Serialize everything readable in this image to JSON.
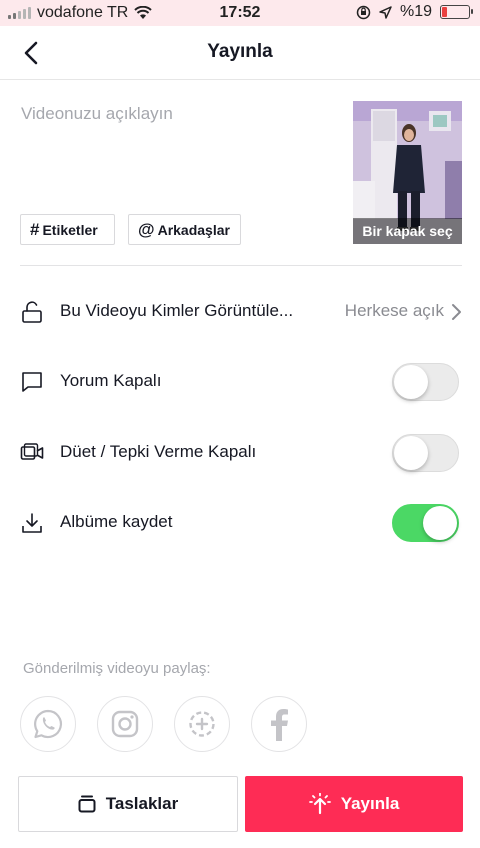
{
  "status_bar": {
    "carrier": "vodafone TR",
    "time": "17:52",
    "battery_percent_label": "%19",
    "battery_level": 0.19,
    "battery_color": "#e84040",
    "icons": [
      "signal-icon",
      "wifi-icon",
      "orientation-lock-icon",
      "location-icon",
      "battery-icon"
    ]
  },
  "header": {
    "title": "Yayınla",
    "back_icon": "chevron-left-icon"
  },
  "description": {
    "placeholder": "Videonuzu açıklayın"
  },
  "cover": {
    "label": "Bir kapak seç"
  },
  "chips": [
    {
      "symbol": "#",
      "label": "Etiketler"
    },
    {
      "symbol": "@",
      "label": "Arkadaşlar"
    }
  ],
  "settings": {
    "privacy": {
      "icon": "unlock-icon",
      "label": "Bu Videoyu Kimler Görüntüle...",
      "value": "Herkese açık"
    },
    "comments": {
      "icon": "comment-icon",
      "label": "Yorum Kapalı",
      "on": false
    },
    "duet": {
      "icon": "duet-icon",
      "label": "Düet / Tepki Verme Kapalı",
      "on": false
    },
    "save": {
      "icon": "download-icon",
      "label": "Albüme kaydet",
      "on": true
    }
  },
  "share": {
    "title": "Gönderilmiş videoyu paylaş:",
    "targets": [
      "whatsapp-icon",
      "instagram-icon",
      "add-story-icon",
      "facebook-icon"
    ]
  },
  "actions": {
    "drafts_label": "Taslaklar",
    "publish_label": "Yayınla"
  },
  "colors": {
    "accent": "#fe2c55",
    "toggle_on": "#4bd865",
    "status_bar_bg": "#fde9ec"
  }
}
